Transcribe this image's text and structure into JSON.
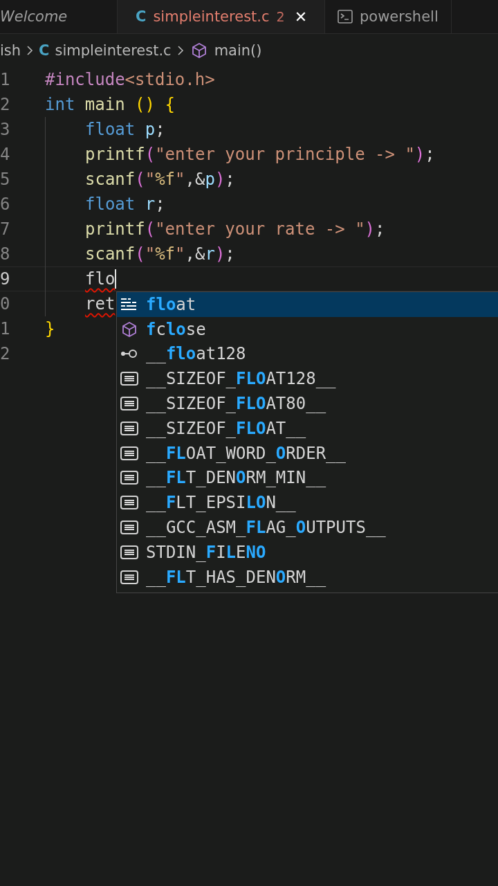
{
  "tabs": [
    {
      "label": "Welcome",
      "kind": "preview",
      "selected": false
    },
    {
      "label": "simpleinterest.c",
      "kind": "file",
      "badge": "C",
      "problems": "2",
      "close": "✕",
      "selected": true
    },
    {
      "label": "powershell",
      "kind": "terminal",
      "selected": false
    }
  ],
  "breadcrumb": [
    {
      "label": "ish",
      "kind": "folder"
    },
    {
      "label": "simpleinterest.c",
      "kind": "file",
      "badge": "C"
    },
    {
      "label": "main()",
      "kind": "function"
    }
  ],
  "code": [
    {
      "number": "1",
      "indented": false,
      "current": false,
      "error": false,
      "tokens": [
        {
          "text": "#include",
          "kind": "preproc"
        },
        {
          "text": "<stdio.h>",
          "kind": "string"
        }
      ]
    },
    {
      "number": "2",
      "indented": false,
      "current": false,
      "error": false,
      "tokens": [
        {
          "text": "int ",
          "kind": "keyword"
        },
        {
          "text": "main ",
          "kind": "func"
        },
        {
          "text": "() ",
          "kind": "bracket"
        },
        {
          "text": "{",
          "kind": "bracket"
        }
      ]
    },
    {
      "number": "3",
      "indented": true,
      "current": false,
      "error": false,
      "tokens": [
        {
          "text": "float ",
          "kind": "keyword"
        },
        {
          "text": "p",
          "kind": "var"
        },
        {
          "text": ";",
          "kind": "punct"
        }
      ]
    },
    {
      "number": "4",
      "indented": true,
      "current": false,
      "error": false,
      "tokens": [
        {
          "text": "printf",
          "kind": "func"
        },
        {
          "text": "(",
          "kind": "bracket2"
        },
        {
          "text": "\"enter your principle -> \"",
          "kind": "string"
        },
        {
          "text": ")",
          "kind": "bracket2"
        },
        {
          "text": ";",
          "kind": "punct"
        }
      ]
    },
    {
      "number": "5",
      "indented": true,
      "current": false,
      "error": false,
      "tokens": [
        {
          "text": "scanf",
          "kind": "func"
        },
        {
          "text": "(",
          "kind": "bracket2"
        },
        {
          "text": "\"",
          "kind": "string"
        },
        {
          "text": "%f",
          "kind": "format"
        },
        {
          "text": "\"",
          "kind": "string"
        },
        {
          "text": ",&",
          "kind": "punct"
        },
        {
          "text": "p",
          "kind": "var"
        },
        {
          "text": ")",
          "kind": "bracket2"
        },
        {
          "text": ";",
          "kind": "punct"
        }
      ]
    },
    {
      "number": "6",
      "indented": true,
      "current": false,
      "error": false,
      "tokens": [
        {
          "text": "float ",
          "kind": "keyword"
        },
        {
          "text": "r",
          "kind": "var"
        },
        {
          "text": ";",
          "kind": "punct"
        }
      ]
    },
    {
      "number": "7",
      "indented": true,
      "current": false,
      "error": false,
      "tokens": [
        {
          "text": "printf",
          "kind": "func"
        },
        {
          "text": "(",
          "kind": "bracket2"
        },
        {
          "text": "\"enter your rate -> \"",
          "kind": "string"
        },
        {
          "text": ")",
          "kind": "bracket2"
        },
        {
          "text": ";",
          "kind": "punct"
        }
      ]
    },
    {
      "number": "8",
      "indented": true,
      "current": false,
      "error": false,
      "tokens": [
        {
          "text": "scanf",
          "kind": "func"
        },
        {
          "text": "(",
          "kind": "bracket2"
        },
        {
          "text": "\"",
          "kind": "string"
        },
        {
          "text": "%f",
          "kind": "format"
        },
        {
          "text": "\"",
          "kind": "string"
        },
        {
          "text": ",&",
          "kind": "punct"
        },
        {
          "text": "r",
          "kind": "var"
        },
        {
          "text": ")",
          "kind": "bracket2"
        },
        {
          "text": ";",
          "kind": "punct"
        }
      ]
    },
    {
      "number": "9",
      "indented": true,
      "current": true,
      "error": true,
      "tokens": [
        {
          "text": "flo",
          "kind": "punct"
        }
      ]
    },
    {
      "number": "0",
      "indented": true,
      "current": false,
      "error": true,
      "tokens": [
        {
          "text": "ret",
          "kind": "punct"
        }
      ]
    },
    {
      "number": "1",
      "indented": false,
      "current": false,
      "error": false,
      "tokens": [
        {
          "text": "}",
          "kind": "bracket"
        }
      ]
    },
    {
      "number": "2",
      "current": false
    }
  ],
  "suggestions": [
    {
      "kind": "keyword",
      "selected": true,
      "label": "**flo**at"
    },
    {
      "kind": "module",
      "selected": false,
      "label": "**f**c**lo**se"
    },
    {
      "kind": "variable",
      "selected": false,
      "label": "__**flo**at128"
    },
    {
      "kind": "constant",
      "selected": false,
      "label": "__SIZEOF_**FLO**AT128__"
    },
    {
      "kind": "constant",
      "selected": false,
      "label": "__SIZEOF_**FLO**AT80__"
    },
    {
      "kind": "constant",
      "selected": false,
      "label": "__SIZEOF_**FLO**AT__"
    },
    {
      "kind": "constant",
      "selected": false,
      "label": "__**FL**OAT_WORD_**O**RDER__"
    },
    {
      "kind": "constant",
      "selected": false,
      "label": "__**FL**T_DEN**O**RM_MIN__"
    },
    {
      "kind": "constant",
      "selected": false,
      "label": "__**F**LT_EPSI**LO**N__"
    },
    {
      "kind": "constant",
      "selected": false,
      "label": "__GCC_ASM_**FL**AG_**O**UTPUTS__"
    },
    {
      "kind": "constant",
      "selected": false,
      "label": "STDIN_**F**I**L**E**NO**"
    },
    {
      "kind": "constant",
      "selected": false,
      "label": "__**FL**T_HAS_DEN**O**RM__"
    }
  ]
}
